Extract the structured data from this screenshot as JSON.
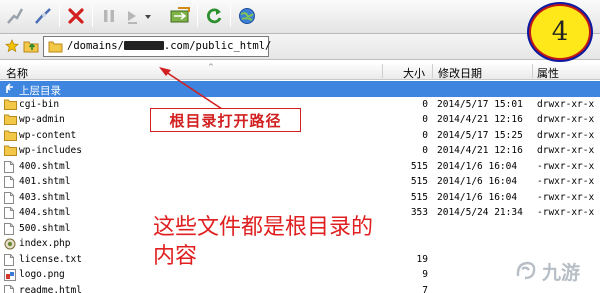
{
  "address": {
    "path_prefix": "/domains/",
    "path_suffix": ".com/public_html/"
  },
  "header": {
    "name": "名称",
    "size": "大小",
    "modified": "修改日期",
    "perms": "属性"
  },
  "parent_row": {
    "label": "上层目录"
  },
  "files": [
    {
      "name": "cgi-bin",
      "size": "0",
      "date": "2014/5/17 15:01",
      "perms": "drwxr-xr-x",
      "type": "folder"
    },
    {
      "name": "wp-admin",
      "size": "0",
      "date": "2014/4/21 12:16",
      "perms": "drwxr-xr-x",
      "type": "folder"
    },
    {
      "name": "wp-content",
      "size": "0",
      "date": "2014/5/17 15:25",
      "perms": "drwxr-xr-x",
      "type": "folder"
    },
    {
      "name": "wp-includes",
      "size": "0",
      "date": "2014/4/21 12:16",
      "perms": "drwxr-xr-x",
      "type": "folder"
    },
    {
      "name": "400.shtml",
      "size": "515",
      "date": "2014/1/6 16:04",
      "perms": "-rwxr-xr-x",
      "type": "file"
    },
    {
      "name": "401.shtml",
      "size": "515",
      "date": "2014/1/6 16:04",
      "perms": "-rwxr-xr-x",
      "type": "file"
    },
    {
      "name": "403.shtml",
      "size": "515",
      "date": "2014/1/6 16:04",
      "perms": "-rwxr-xr-x",
      "type": "file"
    },
    {
      "name": "404.shtml",
      "size": "353",
      "date": "2014/5/24 21:34",
      "perms": "-rwxr-xr-x",
      "type": "file"
    },
    {
      "name": "500.shtml",
      "size": "",
      "date": "",
      "perms": "",
      "type": "file"
    },
    {
      "name": "index.php",
      "size": "",
      "date": "",
      "perms": "",
      "type": "php"
    },
    {
      "name": "license.txt",
      "size": "19",
      "date": "",
      "perms": "",
      "type": "file"
    },
    {
      "name": "logo.png",
      "size": "9",
      "date": "",
      "perms": "",
      "type": "image"
    },
    {
      "name": "readme.html",
      "size": "7",
      "date": "",
      "perms": "",
      "type": "file"
    }
  ],
  "annotations": {
    "badge_number": "4",
    "callout": "根目录打开路径",
    "note": "这些文件都是根目录的内容",
    "watermark": "九游"
  },
  "colors": {
    "selection": "#3d85df",
    "annotation_red": "#e02020",
    "badge_yellow": "#ffe81a"
  }
}
